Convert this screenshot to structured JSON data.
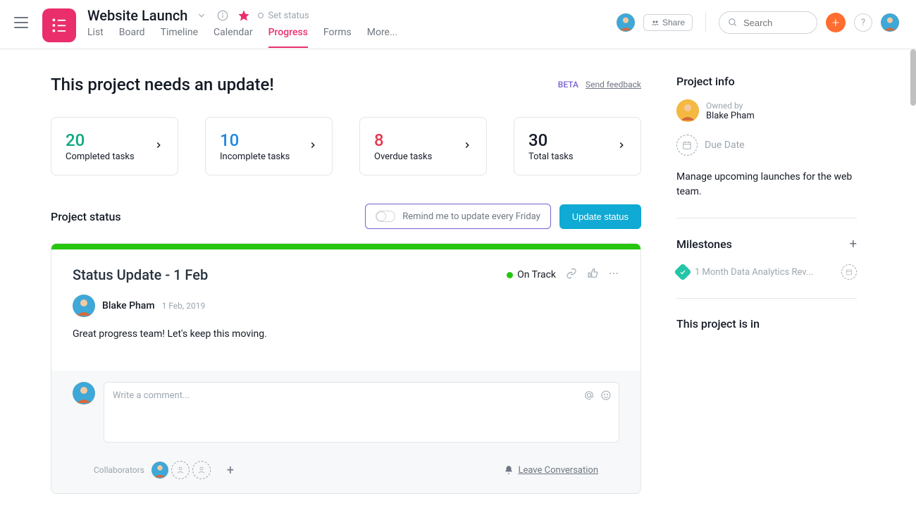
{
  "header": {
    "project_title": "Website Launch",
    "set_status": "Set status",
    "tabs": [
      "List",
      "Board",
      "Timeline",
      "Calendar",
      "Progress",
      "Forms",
      "More..."
    ],
    "active_tab": 4,
    "share": "Share",
    "search_placeholder": "Search"
  },
  "page": {
    "heading": "This project needs an update!",
    "beta": "BETA",
    "feedback": "Send feedback"
  },
  "stats": [
    {
      "num": "20",
      "label": "Completed tasks",
      "color": "c-green"
    },
    {
      "num": "10",
      "label": "Incomplete tasks",
      "color": "c-blue"
    },
    {
      "num": "8",
      "label": "Overdue tasks",
      "color": "c-red"
    },
    {
      "num": "30",
      "label": "Total tasks",
      "color": ""
    }
  ],
  "status": {
    "section_title": "Project status",
    "remind_label": "Remind me to update every Friday",
    "update_btn": "Update status",
    "card": {
      "title": "Status Update - 1 Feb",
      "state": "On Track",
      "author": "Blake Pham",
      "date": "1 Feb, 2019",
      "body": "Great progress team! Let's keep this moving."
    },
    "comment_placeholder": "Write a comment...",
    "collaborators_label": "Collaborators",
    "leave_conversation": "Leave Conversation"
  },
  "project_info": {
    "title": "Project info",
    "owned_by": "Owned by",
    "owner_name": "Blake Pham",
    "due_date": "Due Date",
    "description": "Manage upcoming launches for the web team."
  },
  "milestones": {
    "title": "Milestones",
    "items": [
      "1 Month Data Analytics Rev..."
    ]
  },
  "in_section": {
    "title": "This project is in"
  }
}
